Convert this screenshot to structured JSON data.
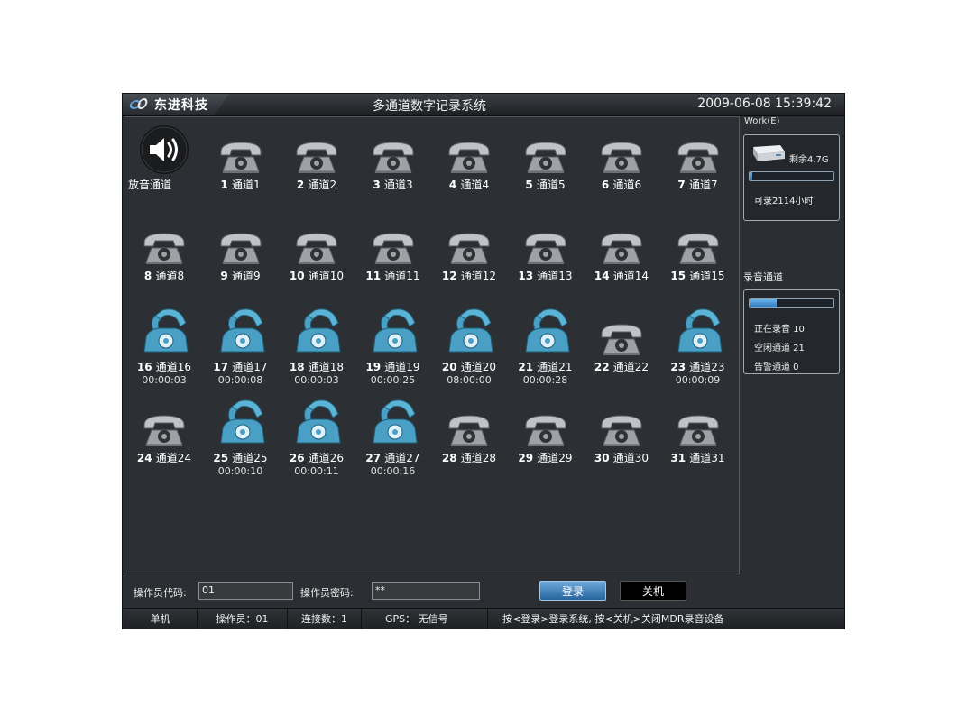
{
  "window": {
    "brand": "东进科技",
    "title": "多通道数字记录系统",
    "datetime": "2009-06-08 15:39:42"
  },
  "playback": {
    "label": "放音通道"
  },
  "channels": [
    {
      "num": "1",
      "name": "通道1",
      "time": "",
      "state": "idle"
    },
    {
      "num": "2",
      "name": "通道2",
      "time": "",
      "state": "idle"
    },
    {
      "num": "3",
      "name": "通道3",
      "time": "",
      "state": "idle"
    },
    {
      "num": "4",
      "name": "通道4",
      "time": "",
      "state": "idle"
    },
    {
      "num": "5",
      "name": "通道5",
      "time": "",
      "state": "idle"
    },
    {
      "num": "6",
      "name": "通道6",
      "time": "",
      "state": "idle"
    },
    {
      "num": "7",
      "name": "通道7",
      "time": "",
      "state": "idle"
    },
    {
      "num": "8",
      "name": "通道8",
      "time": "",
      "state": "idle"
    },
    {
      "num": "9",
      "name": "通道9",
      "time": "",
      "state": "idle"
    },
    {
      "num": "10",
      "name": "通道10",
      "time": "",
      "state": "idle"
    },
    {
      "num": "11",
      "name": "通道11",
      "time": "",
      "state": "idle"
    },
    {
      "num": "12",
      "name": "通道12",
      "time": "",
      "state": "idle"
    },
    {
      "num": "13",
      "name": "通道13",
      "time": "",
      "state": "idle"
    },
    {
      "num": "14",
      "name": "通道14",
      "time": "",
      "state": "idle"
    },
    {
      "num": "15",
      "name": "通道15",
      "time": "",
      "state": "idle"
    },
    {
      "num": "16",
      "name": "通道16",
      "time": "00:00:03",
      "state": "active"
    },
    {
      "num": "17",
      "name": "通道17",
      "time": "00:00:08",
      "state": "active"
    },
    {
      "num": "18",
      "name": "通道18",
      "time": "00:00:03",
      "state": "active"
    },
    {
      "num": "19",
      "name": "通道19",
      "time": "00:00:25",
      "state": "active"
    },
    {
      "num": "20",
      "name": "通道20",
      "time": "08:00:00",
      "state": "active"
    },
    {
      "num": "21",
      "name": "通道21",
      "time": "00:00:28",
      "state": "active"
    },
    {
      "num": "22",
      "name": "通道22",
      "time": "",
      "state": "idle"
    },
    {
      "num": "23",
      "name": "通道23",
      "time": "00:00:09",
      "state": "active"
    },
    {
      "num": "24",
      "name": "通道24",
      "time": "",
      "state": "idle"
    },
    {
      "num": "25",
      "name": "通道25",
      "time": "00:00:10",
      "state": "active"
    },
    {
      "num": "26",
      "name": "通道26",
      "time": "00:00:11",
      "state": "active"
    },
    {
      "num": "27",
      "name": "通道27",
      "time": "00:00:16",
      "state": "active"
    },
    {
      "num": "28",
      "name": "通道28",
      "time": "",
      "state": "idle"
    },
    {
      "num": "29",
      "name": "通道29",
      "time": "",
      "state": "idle"
    },
    {
      "num": "30",
      "name": "通道30",
      "time": "",
      "state": "idle"
    },
    {
      "num": "31",
      "name": "通道31",
      "time": "",
      "state": "idle"
    }
  ],
  "disk": {
    "label": "Work(E)",
    "remaining": "剩余4.7G",
    "usage_fraction": 0.03,
    "capacity_text": "可录2114小时"
  },
  "recording": {
    "title": "录音通道",
    "active_fraction": 0.32,
    "recording_text": "正在录音 10",
    "idle_text": "空闲通道 21",
    "alarm_text": "告警通道 0"
  },
  "login": {
    "operator_code_label": "操作员代码:",
    "operator_code_value": "01",
    "operator_password_label": "操作员密码:",
    "operator_password_value": "**",
    "login_button": "登录",
    "shutdown_button": "关机"
  },
  "statusbar": {
    "mode": "单机",
    "operator": "操作员：01",
    "connections": "连接数：1",
    "gps": "GPS： 无信号",
    "hint": "按<登录>登录系统, 按<关机>关闭MDR录音设备"
  },
  "colors": {
    "background": "#2b2e32",
    "active_channel": "#4aa0c4",
    "idle_channel": "#8e9296",
    "accent_blue": "#2b73b4"
  },
  "icons": {
    "playback": "speaker-icon",
    "idle_channel": "phone-idle-icon",
    "active_channel": "phone-active-icon",
    "disk": "disk-drive-icon"
  }
}
